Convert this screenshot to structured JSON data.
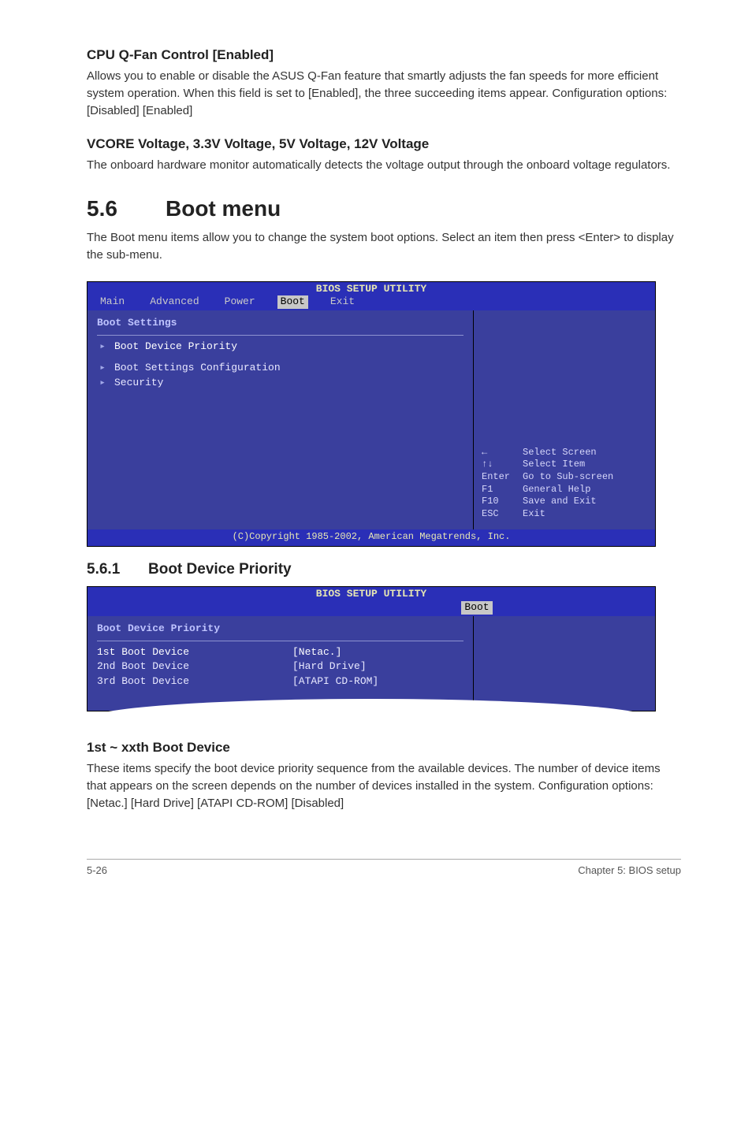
{
  "section1": {
    "title": "CPU Q-Fan Control [Enabled]",
    "body": "Allows you to enable or disable the ASUS Q-Fan feature that smartly adjusts the fan speeds for more efficient system operation. When this field is set to [Enabled], the three succeeding items appear. Configuration options: [Disabled] [Enabled]"
  },
  "section2": {
    "title": "VCORE Voltage, 3.3V Voltage, 5V Voltage, 12V Voltage",
    "body": "The onboard hardware monitor automatically detects the voltage output through the onboard voltage regulators."
  },
  "heading": {
    "num": "5.6",
    "text": "Boot menu"
  },
  "heading_body": "The Boot menu items allow you to change the system boot options. Select an item then press <Enter> to display the sub-menu.",
  "bios1": {
    "title": "BIOS SETUP UTILITY",
    "tabs": [
      "Main",
      "Advanced",
      "Power",
      "Boot",
      "Exit"
    ],
    "selected_tab": "Boot",
    "section_header": "Boot Settings",
    "items": [
      {
        "label": "Boot Device Priority",
        "selected": true
      },
      {
        "label": "Boot Settings Configuration",
        "selected": false
      },
      {
        "label": "Security",
        "selected": false
      }
    ],
    "hints": [
      {
        "key": "←",
        "desc": "Select Screen"
      },
      {
        "key": "↑↓",
        "desc": "Select Item"
      },
      {
        "key": "Enter",
        "desc": "Go to Sub-screen"
      },
      {
        "key": "F1",
        "desc": "General Help"
      },
      {
        "key": "F10",
        "desc": "Save and Exit"
      },
      {
        "key": "ESC",
        "desc": "Exit"
      }
    ],
    "footer": "(C)Copyright 1985-2002, American Megatrends, Inc."
  },
  "subheading": {
    "num": "5.6.1",
    "text": "Boot Device Priority"
  },
  "bios2": {
    "title": "BIOS SETUP UTILITY",
    "selected_tab": "Boot",
    "section_header": "Boot Device Priority",
    "rows": [
      {
        "label": "1st Boot Device",
        "value": "[Netac.]",
        "selected": true
      },
      {
        "label": "2nd Boot Device",
        "value": "[Hard Drive]",
        "selected": false
      },
      {
        "label": "3rd Boot Device",
        "value": "[ATAPI CD-ROM]",
        "selected": false
      }
    ]
  },
  "section3": {
    "title": "1st ~ xxth Boot Device",
    "body": "These items specify the boot device priority sequence from the available devices. The number of device items that appears on the screen depends on the number of devices installed in the system. Configuration options: [Netac.] [Hard Drive] [ATAPI CD-ROM] [Disabled]"
  },
  "footer": {
    "left": "5-26",
    "right": "Chapter 5: BIOS setup"
  }
}
